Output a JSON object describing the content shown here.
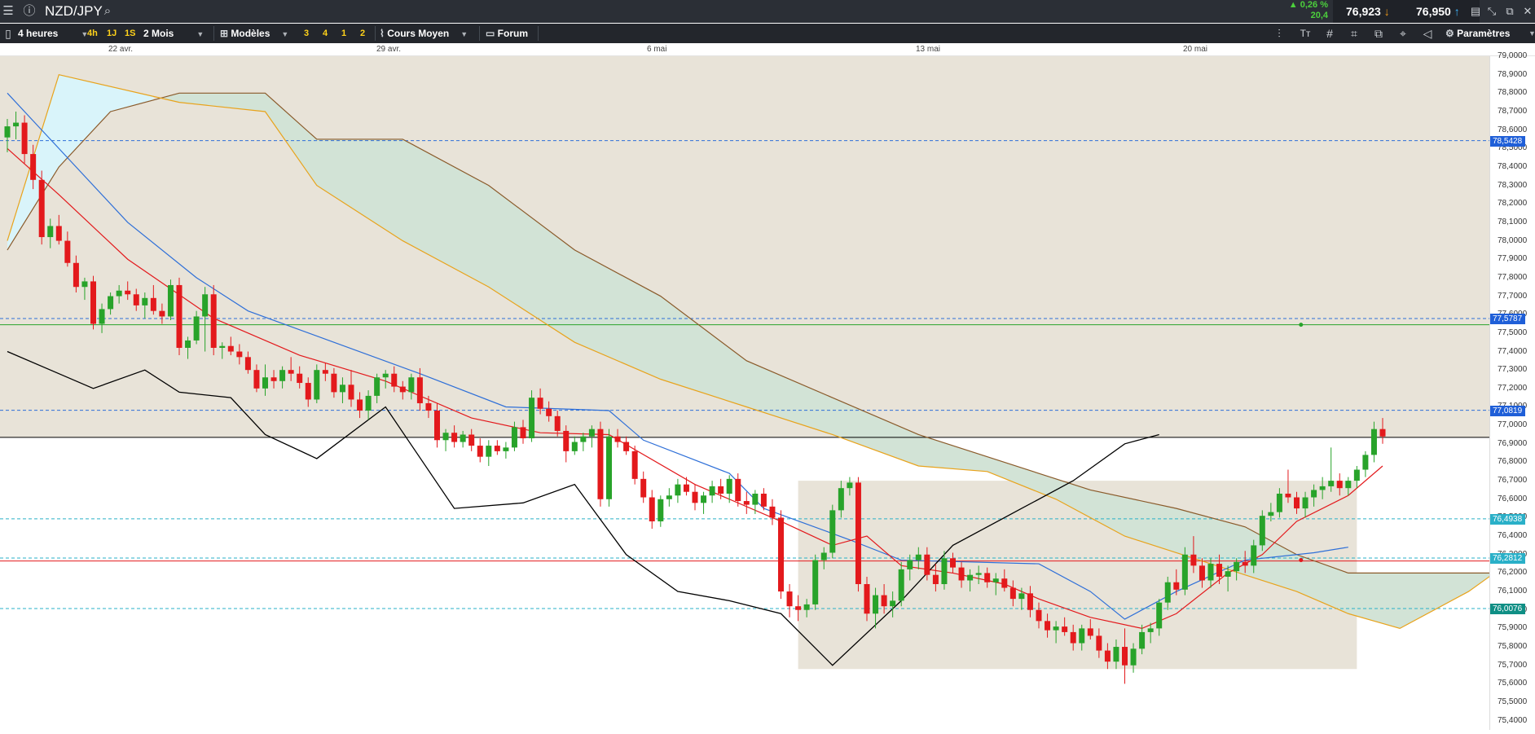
{
  "app": {
    "symbol": "NZD/JPY",
    "change_pct": "▲ 0,26 %",
    "change_pts": "20,4",
    "bid": "76,923",
    "ask": "76,950"
  },
  "toolbar": {
    "timeframe": "4 heures",
    "quick": [
      "4h",
      "1J",
      "1S"
    ],
    "period": "2 Mois",
    "models": "Modèles",
    "quick2": [
      "3",
      "4",
      "1",
      "2"
    ],
    "price_type": "Cours Moyen",
    "forum": "Forum",
    "settings": "Paramètres"
  },
  "colors": {
    "up": "#28a32a",
    "down": "#e3191c",
    "ichimoku_bg": "#e8e3d8",
    "cloud": "#d2e3d6",
    "cloud_cyan": "#d9f4fa",
    "tenkan": "#e3191c",
    "kijun": "#2e6fd8",
    "spanA": "#e8a31c",
    "spanB": "#8a5a2a",
    "chikou": "#000000"
  },
  "chart_data": {
    "type": "candlestick",
    "instrument": "NZD/JPY",
    "timeframe": "4 heures",
    "x_labels": [
      "22 avr.",
      "29 avr.",
      "6 mai",
      "13 mai",
      "20 mai"
    ],
    "ylim": [
      75.35,
      79.0
    ],
    "y_ticks": [
      "79,0000",
      "78,9000",
      "78,8000",
      "78,7000",
      "78,6000",
      "78,5000",
      "78,4000",
      "78,3000",
      "78,2000",
      "78,1000",
      "78,0000",
      "77,9000",
      "77,8000",
      "77,7000",
      "77,6000",
      "77,5000",
      "77,4000",
      "77,3000",
      "77,2000",
      "77,1000",
      "77,0000",
      "76,9000",
      "76,8000",
      "76,7000",
      "76,6000",
      "76,5000",
      "76,4000",
      "76,3000",
      "76,2000",
      "76,1000",
      "76,0000",
      "75,9000",
      "75,8000",
      "75,7000",
      "75,6000",
      "75,5000",
      "75,4000"
    ],
    "horizontal_levels": [
      {
        "label": "78,5428",
        "value": 78.5428,
        "color": "#2e6fd8",
        "style": "dashed"
      },
      {
        "label": "77,5787",
        "value": 77.5787,
        "color": "#2e6fd8",
        "style": "dashed"
      },
      {
        "value": 77.545,
        "color": "#28a32a",
        "style": "solid"
      },
      {
        "label": "77,0819",
        "value": 77.0819,
        "color": "#2e6fd8",
        "style": "dashed"
      },
      {
        "value": 76.935,
        "color": "#000000",
        "style": "solid"
      },
      {
        "label": "76,4938",
        "value": 76.4938,
        "color": "#2ab0c8",
        "style": "dashed"
      },
      {
        "label": "76,2812",
        "value": 76.2812,
        "color": "#2ab0c8",
        "style": "dashed"
      },
      {
        "value": 76.265,
        "color": "#e3191c",
        "style": "solid"
      },
      {
        "label": "76,0076",
        "value": 76.0076,
        "color": "#2ab0c8",
        "style": "dashed"
      }
    ],
    "candles": [
      [
        78.56,
        78.66,
        78.48,
        78.62
      ],
      [
        78.62,
        78.7,
        78.55,
        78.64
      ],
      [
        78.64,
        78.68,
        78.42,
        78.47
      ],
      [
        78.47,
        78.52,
        78.28,
        78.33
      ],
      [
        78.33,
        78.38,
        77.98,
        78.02
      ],
      [
        78.02,
        78.12,
        77.96,
        78.08
      ],
      [
        78.08,
        78.14,
        77.98,
        78.0
      ],
      [
        78.0,
        78.05,
        77.86,
        77.88
      ],
      [
        77.88,
        77.92,
        77.72,
        77.75
      ],
      [
        77.75,
        77.8,
        77.68,
        77.78
      ],
      [
        77.78,
        77.81,
        77.52,
        77.55
      ],
      [
        77.55,
        77.66,
        77.5,
        77.63
      ],
      [
        77.63,
        77.72,
        77.6,
        77.7
      ],
      [
        77.7,
        77.76,
        77.66,
        77.73
      ],
      [
        77.73,
        77.78,
        77.68,
        77.71
      ],
      [
        77.71,
        77.74,
        77.62,
        77.65
      ],
      [
        77.65,
        77.72,
        77.58,
        77.69
      ],
      [
        77.69,
        77.76,
        77.6,
        77.62
      ],
      [
        77.62,
        77.66,
        77.55,
        77.59
      ],
      [
        77.59,
        77.79,
        77.57,
        77.76
      ],
      [
        77.76,
        77.8,
        77.38,
        77.42
      ],
      [
        77.42,
        77.48,
        77.36,
        77.46
      ],
      [
        77.46,
        77.62,
        77.44,
        77.59
      ],
      [
        77.59,
        77.75,
        77.4,
        77.71
      ],
      [
        77.71,
        77.76,
        77.38,
        77.42
      ],
      [
        77.42,
        77.45,
        77.36,
        77.43
      ],
      [
        77.43,
        77.48,
        77.38,
        77.4
      ],
      [
        77.4,
        77.44,
        77.33,
        77.37
      ],
      [
        77.37,
        77.4,
        77.28,
        77.3
      ],
      [
        77.3,
        77.33,
        77.18,
        77.2
      ],
      [
        77.2,
        77.33,
        77.16,
        77.26
      ],
      [
        77.26,
        77.3,
        77.2,
        77.24
      ],
      [
        77.24,
        77.32,
        77.2,
        77.3
      ],
      [
        77.3,
        77.37,
        77.24,
        77.28
      ],
      [
        77.28,
        77.32,
        77.2,
        77.23
      ],
      [
        77.23,
        77.26,
        77.1,
        77.14
      ],
      [
        77.14,
        77.33,
        77.12,
        77.3
      ],
      [
        77.3,
        77.34,
        77.24,
        77.28
      ],
      [
        77.28,
        77.31,
        77.15,
        77.18
      ],
      [
        77.18,
        77.26,
        77.12,
        77.22
      ],
      [
        77.22,
        77.3,
        77.1,
        77.14
      ],
      [
        77.14,
        77.18,
        77.04,
        77.08
      ],
      [
        77.08,
        77.19,
        77.03,
        77.16
      ],
      [
        77.16,
        77.28,
        77.12,
        77.26
      ],
      [
        77.26,
        77.3,
        77.2,
        77.28
      ],
      [
        77.28,
        77.32,
        77.18,
        77.21
      ],
      [
        77.21,
        77.24,
        77.14,
        77.18
      ],
      [
        77.18,
        77.28,
        77.14,
        77.26
      ],
      [
        77.26,
        77.31,
        77.08,
        77.12
      ],
      [
        77.12,
        77.16,
        77.04,
        77.08
      ],
      [
        77.08,
        77.12,
        76.88,
        76.92
      ],
      [
        76.92,
        76.98,
        76.86,
        76.96
      ],
      [
        76.96,
        77.0,
        76.88,
        76.91
      ],
      [
        76.91,
        76.97,
        76.88,
        76.95
      ],
      [
        76.95,
        76.98,
        76.86,
        76.89
      ],
      [
        76.89,
        76.93,
        76.8,
        76.83
      ],
      [
        76.83,
        76.92,
        76.78,
        76.89
      ],
      [
        76.89,
        76.92,
        76.84,
        76.86
      ],
      [
        76.86,
        76.91,
        76.82,
        76.88
      ],
      [
        76.88,
        77.02,
        76.86,
        76.99
      ],
      [
        76.99,
        77.03,
        76.9,
        76.93
      ],
      [
        76.93,
        77.19,
        76.91,
        77.15
      ],
      [
        77.15,
        77.2,
        77.06,
        77.09
      ],
      [
        77.09,
        77.13,
        77.02,
        77.05
      ],
      [
        77.05,
        77.08,
        76.94,
        76.97
      ],
      [
        76.97,
        77.0,
        76.8,
        76.86
      ],
      [
        76.86,
        76.94,
        76.84,
        76.91
      ],
      [
        76.91,
        76.96,
        76.86,
        76.94
      ],
      [
        76.94,
        77.0,
        76.88,
        76.98
      ],
      [
        76.98,
        77.02,
        76.56,
        76.6
      ],
      [
        76.6,
        76.98,
        76.56,
        76.94
      ],
      [
        76.94,
        76.98,
        76.88,
        76.91
      ],
      [
        76.91,
        76.94,
        76.84,
        76.86
      ],
      [
        76.86,
        76.89,
        76.68,
        76.71
      ],
      [
        76.71,
        76.75,
        76.58,
        76.61
      ],
      [
        76.61,
        76.65,
        76.44,
        76.48
      ],
      [
        76.48,
        76.62,
        76.45,
        76.6
      ],
      [
        76.6,
        76.66,
        76.56,
        76.62
      ],
      [
        76.62,
        76.71,
        76.58,
        76.68
      ],
      [
        76.68,
        76.72,
        76.62,
        76.64
      ],
      [
        76.64,
        76.68,
        76.54,
        76.58
      ],
      [
        76.58,
        76.64,
        76.52,
        76.62
      ],
      [
        76.62,
        76.7,
        76.58,
        76.67
      ],
      [
        76.67,
        76.71,
        76.6,
        76.63
      ],
      [
        76.63,
        76.73,
        76.58,
        76.71
      ],
      [
        76.71,
        76.74,
        76.56,
        76.59
      ],
      [
        76.59,
        76.64,
        76.52,
        76.57
      ],
      [
        76.57,
        76.65,
        76.52,
        76.63
      ],
      [
        76.63,
        76.66,
        76.54,
        76.56
      ],
      [
        76.56,
        76.6,
        76.46,
        76.5
      ],
      [
        76.5,
        76.54,
        76.06,
        76.1
      ],
      [
        76.1,
        76.14,
        75.96,
        76.02
      ],
      [
        76.02,
        76.08,
        75.94,
        76.0
      ],
      [
        76.0,
        76.06,
        75.96,
        76.03
      ],
      [
        76.03,
        76.3,
        76.0,
        76.27
      ],
      [
        76.27,
        76.34,
        76.22,
        76.31
      ],
      [
        76.31,
        76.57,
        76.28,
        76.54
      ],
      [
        76.54,
        76.7,
        76.5,
        76.66
      ],
      [
        76.66,
        76.72,
        76.62,
        76.69
      ],
      [
        76.69,
        76.72,
        76.1,
        76.14
      ],
      [
        76.14,
        76.18,
        75.94,
        75.98
      ],
      [
        75.98,
        76.12,
        75.9,
        76.08
      ],
      [
        76.08,
        76.14,
        75.98,
        76.02
      ],
      [
        76.02,
        76.1,
        75.96,
        76.05
      ],
      [
        76.05,
        76.26,
        76.02,
        76.22
      ],
      [
        76.22,
        76.3,
        76.16,
        76.27
      ],
      [
        76.27,
        76.34,
        76.22,
        76.3
      ],
      [
        76.3,
        76.34,
        76.16,
        76.19
      ],
      [
        76.19,
        76.25,
        76.1,
        76.14
      ],
      [
        76.14,
        76.32,
        76.11,
        76.28
      ],
      [
        76.28,
        76.31,
        76.2,
        76.23
      ],
      [
        76.23,
        76.26,
        76.12,
        76.16
      ],
      [
        76.16,
        76.22,
        76.1,
        76.19
      ],
      [
        76.19,
        76.24,
        76.14,
        76.2
      ],
      [
        76.2,
        76.23,
        76.12,
        76.15
      ],
      [
        76.15,
        76.2,
        76.08,
        76.17
      ],
      [
        76.17,
        76.22,
        76.1,
        76.12
      ],
      [
        76.12,
        76.16,
        76.02,
        76.06
      ],
      [
        76.06,
        76.12,
        76.0,
        76.09
      ],
      [
        76.09,
        76.13,
        75.96,
        76.0
      ],
      [
        76.0,
        76.04,
        75.9,
        75.94
      ],
      [
        75.94,
        75.98,
        75.85,
        75.89
      ],
      [
        75.89,
        75.94,
        75.82,
        75.91
      ],
      [
        75.91,
        75.96,
        75.86,
        75.88
      ],
      [
        75.88,
        75.92,
        75.78,
        75.82
      ],
      [
        75.82,
        75.92,
        75.78,
        75.9
      ],
      [
        75.9,
        75.95,
        75.84,
        75.86
      ],
      [
        75.86,
        75.9,
        75.74,
        75.78
      ],
      [
        75.78,
        75.82,
        75.68,
        75.72
      ],
      [
        75.72,
        75.84,
        75.68,
        75.8
      ],
      [
        75.8,
        75.9,
        75.6,
        75.7
      ],
      [
        75.7,
        75.82,
        75.66,
        75.79
      ],
      [
        75.79,
        75.92,
        75.76,
        75.88
      ],
      [
        75.88,
        75.93,
        75.82,
        75.9
      ],
      [
        75.9,
        76.06,
        75.86,
        76.04
      ],
      [
        76.04,
        76.18,
        76.0,
        76.15
      ],
      [
        76.15,
        76.22,
        76.08,
        76.11
      ],
      [
        76.11,
        76.34,
        76.08,
        76.3
      ],
      [
        76.3,
        76.4,
        76.2,
        76.24
      ],
      [
        76.24,
        76.28,
        76.12,
        76.16
      ],
      [
        76.16,
        76.28,
        76.12,
        76.25
      ],
      [
        76.25,
        76.3,
        76.14,
        76.18
      ],
      [
        76.18,
        76.24,
        76.1,
        76.21
      ],
      [
        76.21,
        76.28,
        76.16,
        76.26
      ],
      [
        76.26,
        76.32,
        76.2,
        76.24
      ],
      [
        76.24,
        76.38,
        76.2,
        76.35
      ],
      [
        76.35,
        76.54,
        76.32,
        76.51
      ],
      [
        76.51,
        76.58,
        76.48,
        76.53
      ],
      [
        76.53,
        76.66,
        76.5,
        76.63
      ],
      [
        76.63,
        76.76,
        76.58,
        76.61
      ],
      [
        76.61,
        76.64,
        76.52,
        76.55
      ],
      [
        76.55,
        76.64,
        76.5,
        76.61
      ],
      [
        76.61,
        76.68,
        76.56,
        76.65
      ],
      [
        76.65,
        76.72,
        76.6,
        76.67
      ],
      [
        76.67,
        76.88,
        76.64,
        76.7
      ],
      [
        76.7,
        76.74,
        76.62,
        76.66
      ],
      [
        76.66,
        76.72,
        76.62,
        76.7
      ],
      [
        76.7,
        76.78,
        76.66,
        76.76
      ],
      [
        76.76,
        76.86,
        76.72,
        76.84
      ],
      [
        76.84,
        77.02,
        76.8,
        76.98
      ],
      [
        76.98,
        77.04,
        76.9,
        76.94
      ]
    ],
    "tenkan": [
      [
        0,
        78.5
      ],
      [
        6,
        78.25
      ],
      [
        14,
        77.9
      ],
      [
        24,
        77.58
      ],
      [
        34,
        77.38
      ],
      [
        44,
        77.24
      ],
      [
        54,
        77.04
      ],
      [
        62,
        76.96
      ],
      [
        70,
        76.95
      ],
      [
        80,
        76.68
      ],
      [
        90,
        76.48
      ],
      [
        96,
        76.35
      ],
      [
        100,
        76.4
      ],
      [
        104,
        76.24
      ],
      [
        110,
        76.2
      ],
      [
        116,
        76.14
      ],
      [
        120,
        76.06
      ],
      [
        126,
        75.96
      ],
      [
        132,
        75.9
      ],
      [
        136,
        75.98
      ],
      [
        142,
        76.2
      ],
      [
        146,
        76.3
      ],
      [
        150,
        76.48
      ],
      [
        156,
        76.62
      ],
      [
        160,
        76.78
      ]
    ],
    "kijun": [
      [
        0,
        78.8
      ],
      [
        4,
        78.6
      ],
      [
        14,
        78.1
      ],
      [
        22,
        77.8
      ],
      [
        28,
        77.62
      ],
      [
        38,
        77.45
      ],
      [
        48,
        77.28
      ],
      [
        58,
        77.1
      ],
      [
        70,
        77.08
      ],
      [
        74,
        76.92
      ],
      [
        84,
        76.74
      ],
      [
        88,
        76.55
      ],
      [
        98,
        76.38
      ],
      [
        104,
        76.27
      ],
      [
        120,
        76.25
      ],
      [
        126,
        76.1
      ],
      [
        130,
        75.95
      ],
      [
        136,
        76.1
      ],
      [
        144,
        76.27
      ],
      [
        152,
        76.31
      ],
      [
        156,
        76.34
      ]
    ],
    "senkou_a": [
      [
        0,
        78.0
      ],
      [
        6,
        78.9
      ],
      [
        20,
        78.75
      ],
      [
        30,
        78.7
      ],
      [
        36,
        78.3
      ],
      [
        46,
        78.0
      ],
      [
        56,
        77.75
      ],
      [
        66,
        77.45
      ],
      [
        76,
        77.25
      ],
      [
        86,
        77.1
      ],
      [
        96,
        76.95
      ],
      [
        106,
        76.78
      ],
      [
        114,
        76.75
      ],
      [
        122,
        76.6
      ],
      [
        130,
        76.4
      ],
      [
        140,
        76.25
      ],
      [
        150,
        76.1
      ],
      [
        156,
        75.98
      ],
      [
        162,
        75.9
      ],
      [
        170,
        76.1
      ],
      [
        176,
        76.3
      ],
      [
        182,
        76.4
      ],
      [
        186,
        76.55
      ]
    ],
    "senkou_b": [
      [
        0,
        77.95
      ],
      [
        6,
        78.4
      ],
      [
        12,
        78.7
      ],
      [
        20,
        78.8
      ],
      [
        30,
        78.8
      ],
      [
        36,
        78.55
      ],
      [
        46,
        78.55
      ],
      [
        56,
        78.3
      ],
      [
        66,
        77.95
      ],
      [
        76,
        77.7
      ],
      [
        86,
        77.35
      ],
      [
        96,
        77.15
      ],
      [
        106,
        76.95
      ],
      [
        116,
        76.8
      ],
      [
        126,
        76.65
      ],
      [
        136,
        76.55
      ],
      [
        144,
        76.45
      ],
      [
        150,
        76.3
      ],
      [
        156,
        76.2
      ],
      [
        170,
        76.2
      ],
      [
        182,
        76.2
      ],
      [
        186,
        76.3
      ]
    ],
    "chikou": [
      [
        0,
        77.4
      ],
      [
        6,
        77.28
      ],
      [
        10,
        77.2
      ],
      [
        16,
        77.3
      ],
      [
        20,
        77.18
      ],
      [
        26,
        77.15
      ],
      [
        30,
        76.95
      ],
      [
        36,
        76.82
      ],
      [
        44,
        77.1
      ],
      [
        52,
        76.55
      ],
      [
        60,
        76.58
      ],
      [
        66,
        76.68
      ],
      [
        72,
        76.3
      ],
      [
        78,
        76.1
      ],
      [
        84,
        76.05
      ],
      [
        90,
        75.98
      ],
      [
        96,
        75.7
      ],
      [
        104,
        76.05
      ],
      [
        110,
        76.35
      ],
      [
        118,
        76.55
      ],
      [
        124,
        76.7
      ],
      [
        130,
        76.9
      ],
      [
        134,
        76.95
      ]
    ]
  }
}
